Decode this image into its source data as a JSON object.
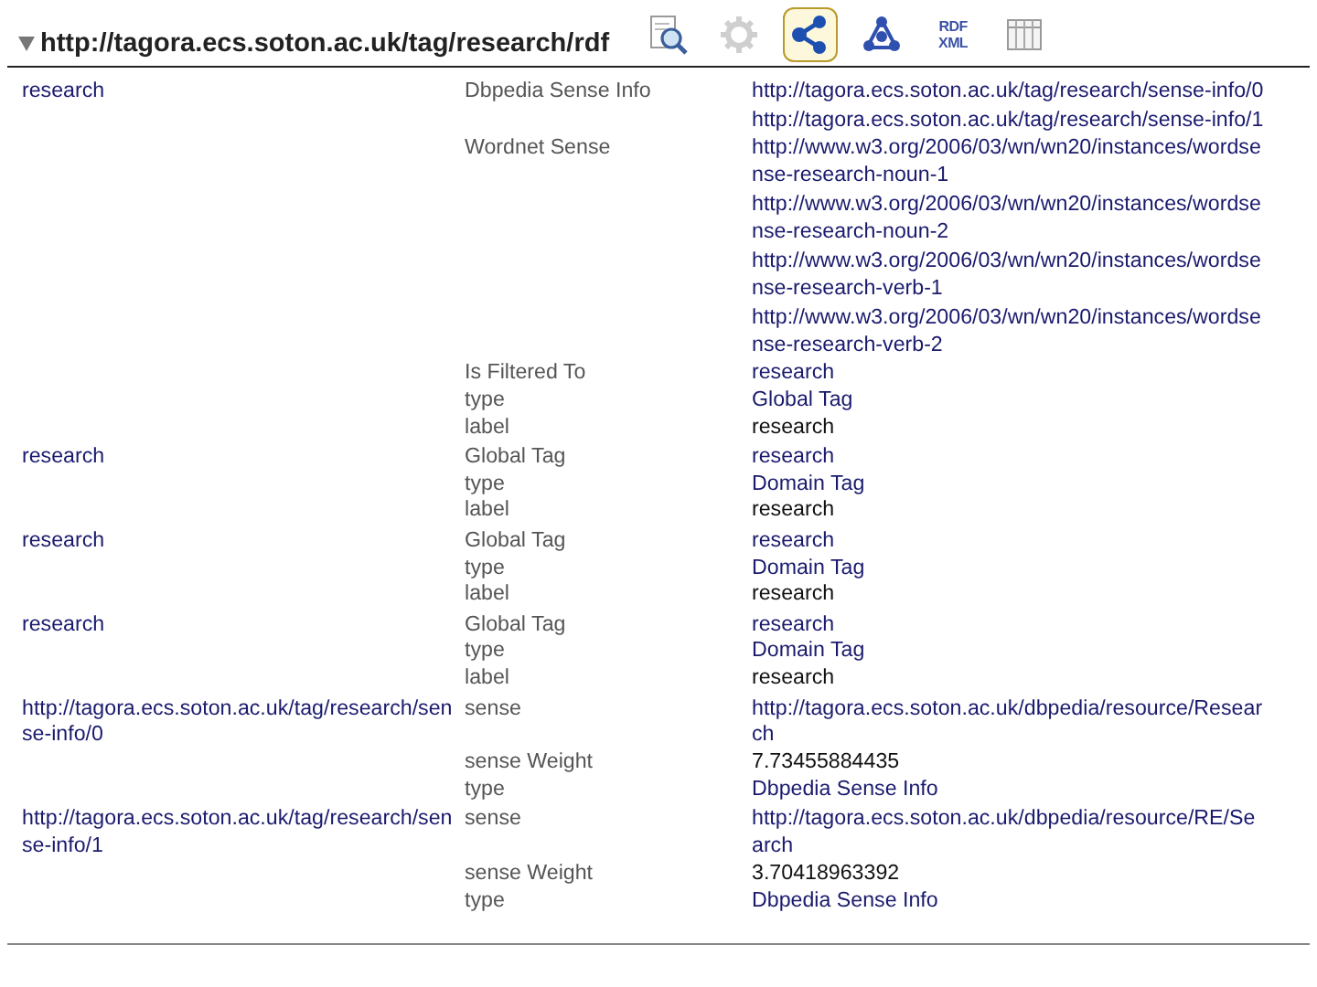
{
  "header": {
    "expanded": true,
    "title": "http://tagora.ecs.soton.ac.uk/tag/research/rdf"
  },
  "toolbar": [
    {
      "kind": "inspect",
      "selected": false,
      "disabled": false
    },
    {
      "kind": "gear",
      "selected": false,
      "disabled": true
    },
    {
      "kind": "graph",
      "selected": true,
      "disabled": false
    },
    {
      "kind": "triangle-graph",
      "selected": false,
      "disabled": false
    },
    {
      "kind": "rdfxml",
      "selected": false,
      "disabled": false,
      "lines": [
        "RDF",
        "XML"
      ]
    },
    {
      "kind": "table",
      "selected": false,
      "disabled": false
    }
  ],
  "groups": [
    {
      "subject": "research",
      "properties": [
        {
          "predicate": "Dbpedia Sense Info",
          "values": [
            {
              "text": "http://tagora.ecs.soton.ac.uk/tag/research/sense-info/0",
              "kind": "link"
            },
            {
              "text": "http://tagora.ecs.soton.ac.uk/tag/research/sense-info/1",
              "kind": "link"
            }
          ]
        },
        {
          "predicate": "Wordnet Sense",
          "values": [
            {
              "text": "http://www.w3.org/2006/03/wn/wn20/instances/wordsense-research-noun-1",
              "kind": "link"
            },
            {
              "text": "http://www.w3.org/2006/03/wn/wn20/instances/wordsense-research-noun-2",
              "kind": "link"
            },
            {
              "text": "http://www.w3.org/2006/03/wn/wn20/instances/wordsense-research-verb-1",
              "kind": "link"
            },
            {
              "text": "http://www.w3.org/2006/03/wn/wn20/instances/wordsense-research-verb-2",
              "kind": "link"
            }
          ]
        },
        {
          "predicate": "Is Filtered To",
          "values": [
            {
              "text": "research",
              "kind": "link"
            }
          ]
        },
        {
          "predicate": "type",
          "values": [
            {
              "text": "Global Tag",
              "kind": "link"
            }
          ]
        },
        {
          "predicate": "label",
          "values": [
            {
              "text": "research",
              "kind": "literal"
            }
          ]
        }
      ]
    },
    {
      "subject": "research",
      "properties": [
        {
          "predicate": "Global Tag",
          "values": [
            {
              "text": "research",
              "kind": "link"
            }
          ]
        },
        {
          "predicate": "type",
          "values": [
            {
              "text": "Domain Tag",
              "kind": "link"
            }
          ]
        },
        {
          "predicate": "label",
          "values": [
            {
              "text": "research",
              "kind": "literal"
            }
          ]
        }
      ]
    },
    {
      "subject": "research",
      "properties": [
        {
          "predicate": "Global Tag",
          "values": [
            {
              "text": "research",
              "kind": "link"
            }
          ]
        },
        {
          "predicate": "type",
          "values": [
            {
              "text": "Domain Tag",
              "kind": "link"
            }
          ]
        },
        {
          "predicate": "label",
          "values": [
            {
              "text": "research",
              "kind": "literal"
            }
          ]
        }
      ]
    },
    {
      "subject": "research",
      "properties": [
        {
          "predicate": "Global Tag",
          "values": [
            {
              "text": "research",
              "kind": "link"
            }
          ]
        },
        {
          "predicate": "type",
          "values": [
            {
              "text": "Domain Tag",
              "kind": "link"
            }
          ]
        },
        {
          "predicate": "label",
          "values": [
            {
              "text": "research",
              "kind": "literal"
            }
          ]
        }
      ]
    },
    {
      "subject": "http://tagora.ecs.soton.ac.uk/tag/research/sense-info/0",
      "properties": [
        {
          "predicate": "sense",
          "values": [
            {
              "text": "http://tagora.ecs.soton.ac.uk/dbpedia/resource/Research",
              "kind": "link"
            }
          ]
        },
        {
          "predicate": "sense Weight",
          "values": [
            {
              "text": "7.73455884435",
              "kind": "literal"
            }
          ]
        },
        {
          "predicate": "type",
          "values": [
            {
              "text": "Dbpedia Sense Info",
              "kind": "link"
            }
          ]
        }
      ]
    },
    {
      "subject": "http://tagora.ecs.soton.ac.uk/tag/research/sense-info/1",
      "properties": [
        {
          "predicate": "sense",
          "values": [
            {
              "text": "http://tagora.ecs.soton.ac.uk/dbpedia/resource/RE/Search",
              "kind": "link"
            }
          ]
        },
        {
          "predicate": "sense Weight",
          "values": [
            {
              "text": "3.70418963392",
              "kind": "literal"
            }
          ]
        },
        {
          "predicate": "type",
          "values": [
            {
              "text": "Dbpedia Sense Info",
              "kind": "link"
            }
          ]
        }
      ]
    }
  ]
}
